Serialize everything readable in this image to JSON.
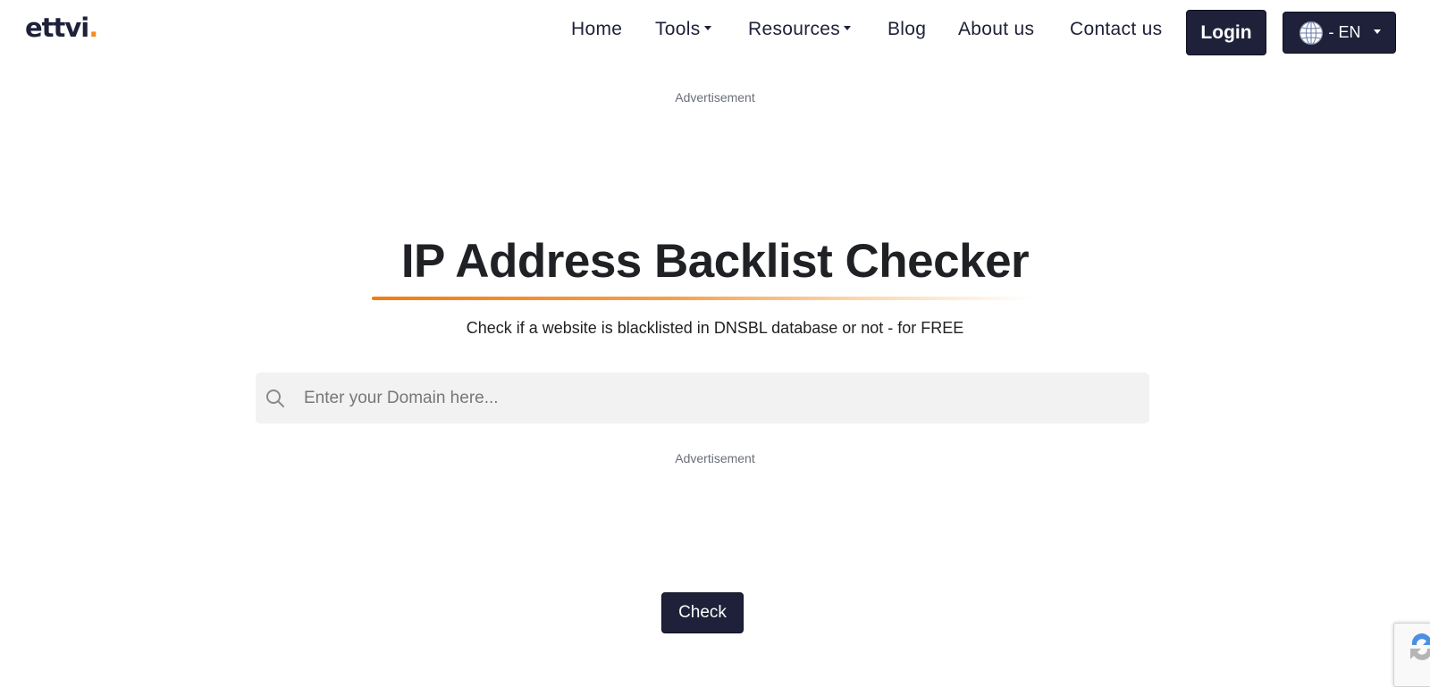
{
  "header": {
    "logo_text": "ettvi",
    "logo_dot": ".",
    "nav": [
      {
        "label": "Home",
        "has_dropdown": false
      },
      {
        "label": "Tools",
        "has_dropdown": true
      },
      {
        "label": "Resources",
        "has_dropdown": true
      },
      {
        "label": "Blog",
        "has_dropdown": false
      },
      {
        "label": "About us",
        "has_dropdown": false
      },
      {
        "label": "Contact us",
        "has_dropdown": false
      }
    ],
    "login_label": "Login",
    "language_label": "- EN",
    "language_icon": "globe-icon"
  },
  "ads": {
    "top_label": "Advertisement",
    "bottom_label": "Advertisement"
  },
  "main": {
    "title": "IP Address Backlist Checker",
    "subtitle": "Check if a website is blacklisted in DNSBL database or not - for FREE",
    "search": {
      "icon": "search-icon",
      "placeholder": "Enter your Domain here...",
      "value": ""
    },
    "check_label": "Check"
  },
  "colors": {
    "brand_dark": "#1e2139",
    "accent_orange": "#f68a1f",
    "input_bg": "#f2f2f2"
  }
}
